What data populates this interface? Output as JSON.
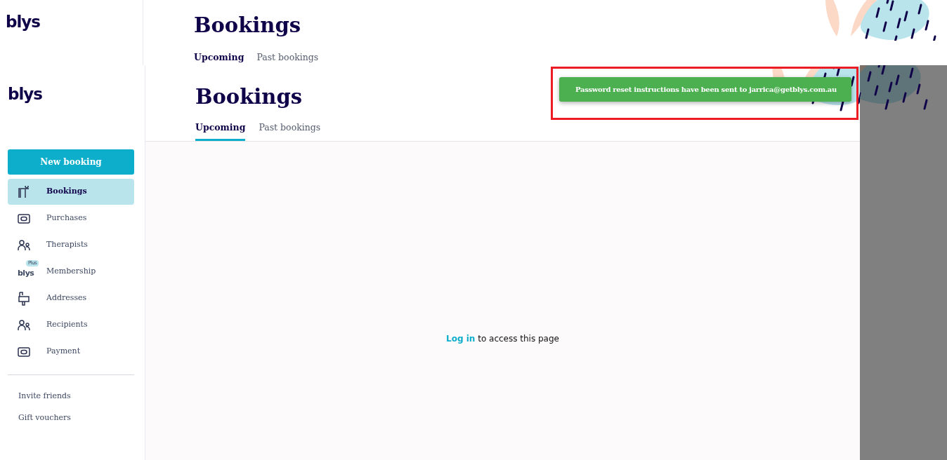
{
  "background_page": {
    "logo": "blys",
    "title": "Bookings",
    "tabs": [
      {
        "label": "Upcoming",
        "selected": true
      },
      {
        "label": "Past bookings",
        "selected": false
      }
    ]
  },
  "page": {
    "logo": "blys",
    "new_booking_button": "New booking",
    "nav": [
      {
        "label": "Bookings",
        "selected": true,
        "kind": "icon"
      },
      {
        "label": "Purchases",
        "selected": false,
        "kind": "icon"
      },
      {
        "label": "Therapists",
        "selected": false,
        "kind": "icon"
      },
      {
        "label": "Membership",
        "selected": false,
        "kind": "logo",
        "logo": "blys",
        "badge": "Plus"
      },
      {
        "label": "Addresses",
        "selected": false,
        "kind": "icon"
      },
      {
        "label": "Recipients",
        "selected": false,
        "kind": "icon"
      },
      {
        "label": "Payment",
        "selected": false,
        "kind": "icon"
      }
    ],
    "secondary_links": [
      "Invite friends",
      "Gift vouchers"
    ],
    "title": "Bookings",
    "tabs": [
      {
        "label": "Upcoming",
        "selected": true
      },
      {
        "label": "Past bookings",
        "selected": false
      }
    ],
    "message": {
      "link": "Log in",
      "text": "to access this page"
    }
  },
  "toast": {
    "message": "Password reset instructions have been sent to jarrica@getblys.com.au"
  }
}
